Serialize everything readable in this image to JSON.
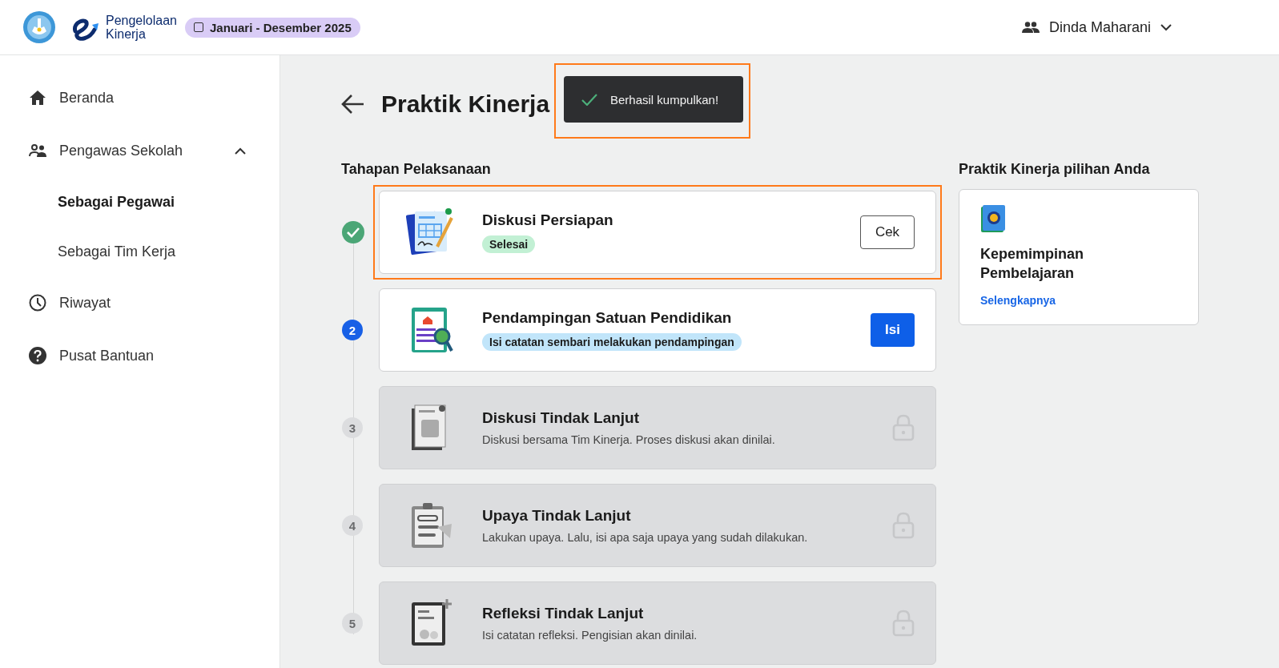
{
  "header": {
    "app_name_line1": "Pengelolaan",
    "app_name_line2": "Kinerja",
    "period": "Januari - Desember 2025",
    "user": "Dinda Maharani"
  },
  "sidebar": {
    "items": [
      {
        "label": "Beranda",
        "kind": "home",
        "selected": false
      },
      {
        "label": "Pengawas Sekolah",
        "kind": "people",
        "selected": false,
        "expanded": true,
        "children": [
          {
            "label": "Sebagai Pegawai",
            "selected": true
          },
          {
            "label": "Sebagai Tim Kerja",
            "selected": false
          }
        ]
      },
      {
        "label": "Riwayat",
        "kind": "clock",
        "selected": false
      },
      {
        "label": "Pusat Bantuan",
        "kind": "help",
        "selected": false
      }
    ]
  },
  "page": {
    "title": "Praktik Kinerja"
  },
  "toast": {
    "message": "Berhasil kumpulkan!",
    "highlighted": true
  },
  "steps_heading": "Tahapan Pelaksanaan",
  "steps": [
    {
      "kind": "done",
      "title": "Diskusi Persiapan",
      "badge": "Selesai",
      "button": "Cek",
      "highlighted": true
    },
    {
      "kind": "active",
      "number": "2",
      "title": "Pendampingan Satuan Pendidikan",
      "badge": "Isi catatan sembari melakukan pendampingan",
      "button": "Isi",
      "highlighted": false
    },
    {
      "kind": "locked",
      "number": "3",
      "title": "Diskusi Tindak Lanjut",
      "description": "Diskusi bersama Tim Kinerja. Proses diskusi akan dinilai.",
      "highlighted": false
    },
    {
      "kind": "locked",
      "number": "4",
      "title": "Upaya Tindak Lanjut",
      "description": "Lakukan upaya. Lalu, isi apa saja upaya yang sudah dilakukan.",
      "highlighted": false
    },
    {
      "kind": "locked",
      "number": "5",
      "title": "Refleksi Tindak Lanjut",
      "description": "Isi catatan refleksi. Pengisian akan dinilai.",
      "highlighted": false
    }
  ],
  "choice": {
    "heading": "Praktik Kinerja pilihan Anda",
    "title": "Kepemimpinan Pembelajaran",
    "link": "Selengkapnya"
  }
}
